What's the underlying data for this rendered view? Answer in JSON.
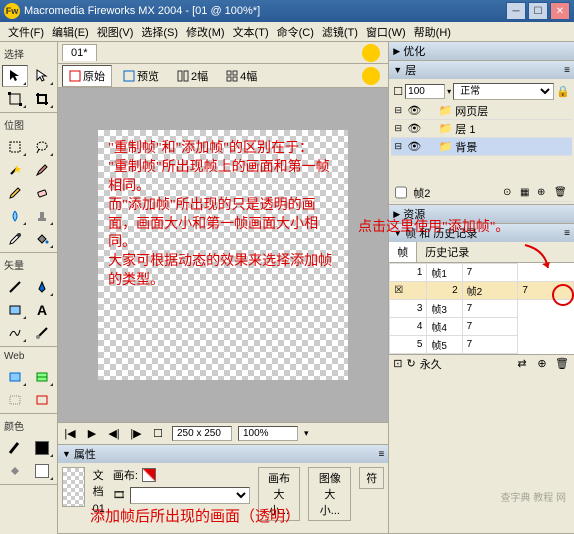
{
  "title": "Macromedia Fireworks MX 2004 - [01 @ 100%*]",
  "menus": [
    "文件(F)",
    "编辑(E)",
    "视图(V)",
    "选择(S)",
    "修改(M)",
    "文本(T)",
    "命令(C)",
    "滤镜(T)",
    "窗口(W)",
    "帮助(H)"
  ],
  "tool_sections": {
    "select": "选择",
    "bitmap": "位图",
    "vector": "矢量",
    "web": "Web",
    "colors": "颜色"
  },
  "doc_tab": "01*",
  "doc_toolbar": {
    "original": "原始",
    "preview": "预览",
    "two_up": "2幅",
    "four_up": "4幅"
  },
  "canvas_text": "\"重制帧\"和\"添加帧\"的区别在于：\n\"重制帧\"所出现帧上的画面和第一帧相同。\n而\"添加帧\"所出现的只是透明的画面，画面大小和第一帧画面大小相同。\n大家可根据动态的效果来选择添加帧的类型。",
  "status": {
    "size": "250 x 250",
    "zoom": "100%"
  },
  "panels": {
    "optimize": "优化",
    "layers": "层",
    "assets": "资源",
    "frames_history": "帧 和 历史记录"
  },
  "layers": {
    "opacity": "100",
    "blend": "正常",
    "items": [
      {
        "name": "网页层"
      },
      {
        "name": "层 1"
      },
      {
        "name": "背景"
      }
    ]
  },
  "frame_current": {
    "name": "帧2"
  },
  "frame_tabs": {
    "frames": "帧",
    "history": "历史记录"
  },
  "frames": [
    {
      "num": "1",
      "name": "帧1",
      "dur": "7"
    },
    {
      "num": "2",
      "name": "帧2",
      "dur": "7"
    },
    {
      "num": "3",
      "name": "帧3",
      "dur": "7"
    },
    {
      "num": "4",
      "name": "帧4",
      "dur": "7"
    },
    {
      "num": "5",
      "name": "帧5",
      "dur": "7"
    }
  ],
  "frame_footer": {
    "loop": "永久"
  },
  "annotation_right": "点击这里使用\"添加帧\"。",
  "props": {
    "title": "属性",
    "doc_label": "文档",
    "doc_name": "01",
    "canvas_label": "画布:",
    "canvas_size_btn": "画布大小...",
    "image_size_btn": "图像大小...",
    "fit_btn": "符"
  },
  "bottom_annotation": "添加帧后所出现的画面（透明）",
  "watermark": "查字典 教程 网"
}
